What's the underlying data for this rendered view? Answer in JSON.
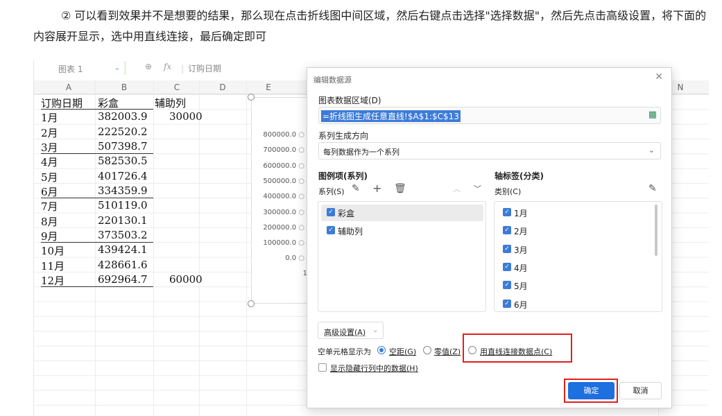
{
  "instruction": "② 可以看到效果并不是想要的结果，那么现在点击折线图中间区域，然后右键点击选择\"选择数据\"，然后先点击高级设置，将下面的内容展开显示，选中用直线连接，最后确定即可",
  "formula_bar": {
    "name_box": "图表 1",
    "fx": "fx",
    "content": "订购日期"
  },
  "columns": [
    "A",
    "B",
    "C",
    "D",
    "E",
    "N"
  ],
  "rows": [
    {
      "a": "订购日期",
      "b": "彩盒",
      "c": "辅助列"
    },
    {
      "a": "1月",
      "b": "382003.9",
      "c": "30000"
    },
    {
      "a": "2月",
      "b": "222520.2",
      "c": ""
    },
    {
      "a": "3月",
      "b": "507398.7",
      "c": ""
    },
    {
      "a": "4月",
      "b": "582530.5",
      "c": ""
    },
    {
      "a": "5月",
      "b": "401726.4",
      "c": ""
    },
    {
      "a": "6月",
      "b": "334359.9",
      "c": ""
    },
    {
      "a": "7月",
      "b": "510119.0",
      "c": ""
    },
    {
      "a": "8月",
      "b": "220130.1",
      "c": ""
    },
    {
      "a": "9月",
      "b": "373503.2",
      "c": ""
    },
    {
      "a": "10月",
      "b": "439424.1",
      "c": ""
    },
    {
      "a": "11月",
      "b": "428661.6",
      "c": ""
    },
    {
      "a": "12月",
      "b": "692964.7",
      "c": "60000"
    }
  ],
  "chart_ticks": [
    "800000.0",
    "700000.0",
    "600000.0",
    "500000.0",
    "400000.0",
    "300000.0",
    "200000.0",
    "100000.0",
    "0.0"
  ],
  "chart_x_partial": "1",
  "dialog": {
    "title": "编辑数据源",
    "range_label": "图表数据区域(D)",
    "range_value": "=折线图生成任意直线!$A$1:$C$13",
    "direction_label": "系列生成方向",
    "direction_value": "每列数据作为一个系列",
    "legend_title": "图例项(系列)",
    "series_label": "系列(S)",
    "axis_title": "轴标签(分类)",
    "category_label": "类别(C)",
    "series": [
      {
        "label": "彩盒",
        "checked": true
      },
      {
        "label": "辅助列",
        "checked": true
      }
    ],
    "categories": [
      {
        "label": "1月",
        "checked": true
      },
      {
        "label": "2月",
        "checked": true
      },
      {
        "label": "3月",
        "checked": true
      },
      {
        "label": "4月",
        "checked": true
      },
      {
        "label": "5月",
        "checked": true
      },
      {
        "label": "6月",
        "checked": true
      }
    ],
    "advanced_label": "高级设置(A)",
    "empty_cells_label": "空单元格显示为",
    "opt_gap": "空距(G)",
    "opt_zero": "零值(Z)",
    "opt_connect": "用直线连接数据点(C)",
    "hidden_label": "显示隐藏行列中的数据(H)",
    "ok": "确定",
    "cancel": "取消",
    "accent": "#1e6fe0",
    "highlight": "#e0201b"
  }
}
